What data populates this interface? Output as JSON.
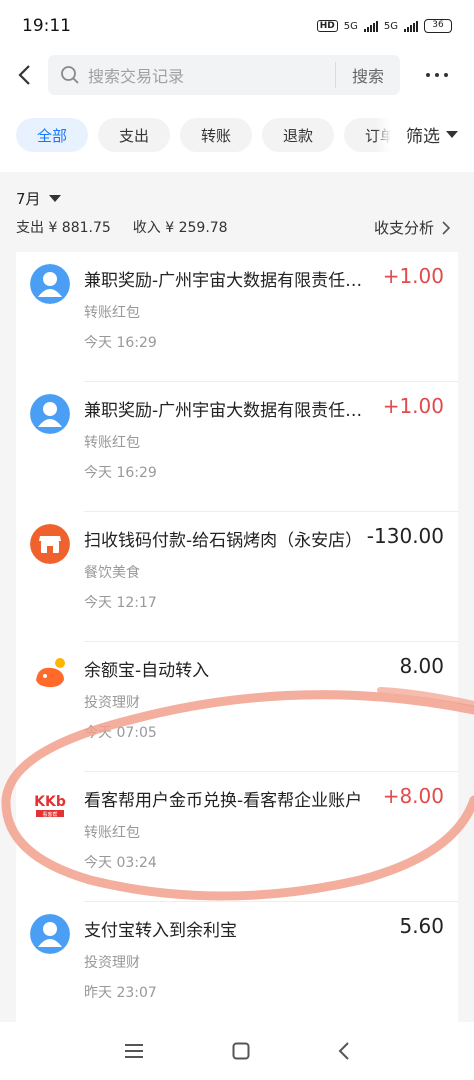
{
  "status": {
    "time": "19:11",
    "hd": "HD",
    "net1": "5G",
    "net2": "5G",
    "battery": "36"
  },
  "search": {
    "placeholder": "搜索交易记录",
    "button": "搜索"
  },
  "filters": [
    {
      "label": "全部",
      "active": true
    },
    {
      "label": "支出"
    },
    {
      "label": "转账"
    },
    {
      "label": "退款"
    },
    {
      "label": "订单"
    }
  ],
  "screen_label": "筛选",
  "month": {
    "label": "7月",
    "expense": "支出 ¥ 881.75",
    "income": "收入 ¥ 259.78",
    "analysis": "收支分析"
  },
  "transactions": [
    {
      "title": "兼职奖励-广州宇宙大数据有限责任公司",
      "category": "转账红包",
      "time": "今天 16:29",
      "amount": "+1.00",
      "type": "income",
      "icon": "user-avatar-icon"
    },
    {
      "title": "兼职奖励-广州宇宙大数据有限责任公司",
      "category": "转账红包",
      "time": "今天 16:29",
      "amount": "+1.00",
      "type": "income",
      "icon": "user-avatar-icon"
    },
    {
      "title": "扫收钱码付款-给石锅烤肉（永安店）",
      "category": "餐饮美食",
      "time": "今天 12:17",
      "amount": "-130.00",
      "type": "expense",
      "icon": "shop-icon"
    },
    {
      "title": "余额宝-自动转入",
      "category": "投资理财",
      "time": "今天 07:05",
      "amount": "8.00",
      "type": "neutral",
      "icon": "yuebao-icon"
    },
    {
      "title": "看客帮用户金币兑换-看客帮企业账户",
      "category": "转账红包",
      "time": "今天 03:24",
      "amount": "+8.00",
      "type": "income",
      "icon": "kkb-logo-icon",
      "logo_text": "KKb",
      "logo_sub": "看客帮"
    },
    {
      "title": "支付宝转入到余利宝",
      "category": "投资理财",
      "time": "昨天 23:07",
      "amount": "5.60",
      "type": "neutral",
      "icon": "user-avatar-icon"
    }
  ],
  "colors": {
    "accent": "#1677ff",
    "income": "#e14b4b",
    "annotation": "#f2a08c"
  }
}
